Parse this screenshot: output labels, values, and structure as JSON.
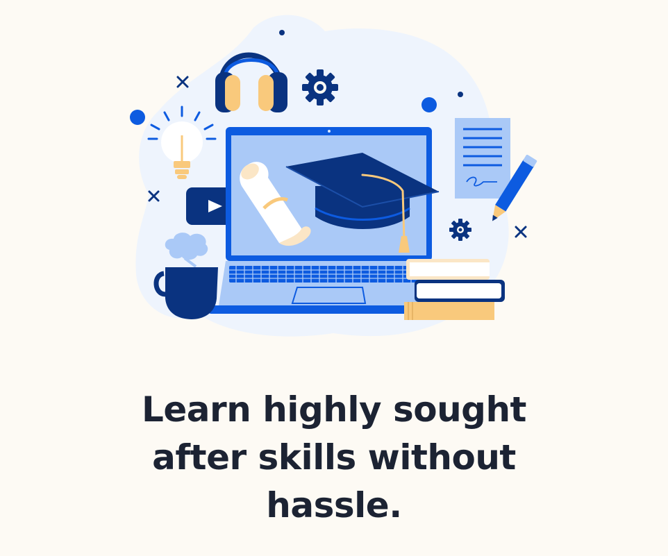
{
  "illustration": {
    "theme": "online-learning",
    "icons": [
      "laptop-icon",
      "graduation-cap-icon",
      "diploma-scroll-icon",
      "headphones-icon",
      "gear-icon",
      "lightbulb-icon",
      "video-play-icon",
      "coffee-mug-icon",
      "speech-cloud-icon",
      "document-icon",
      "pencil-icon",
      "book-stack-icon"
    ],
    "colors": {
      "primary_blue": "#0d5be0",
      "dark_navy": "#0a3380",
      "light_blue": "#a9c8f7",
      "pale_blue": "#eef4fd",
      "accent_yellow": "#f9c97c",
      "cream": "#fbe6c6"
    }
  },
  "headline": {
    "line1": "Learn highly sought",
    "line2": "after skills without",
    "line3": "hassle."
  }
}
